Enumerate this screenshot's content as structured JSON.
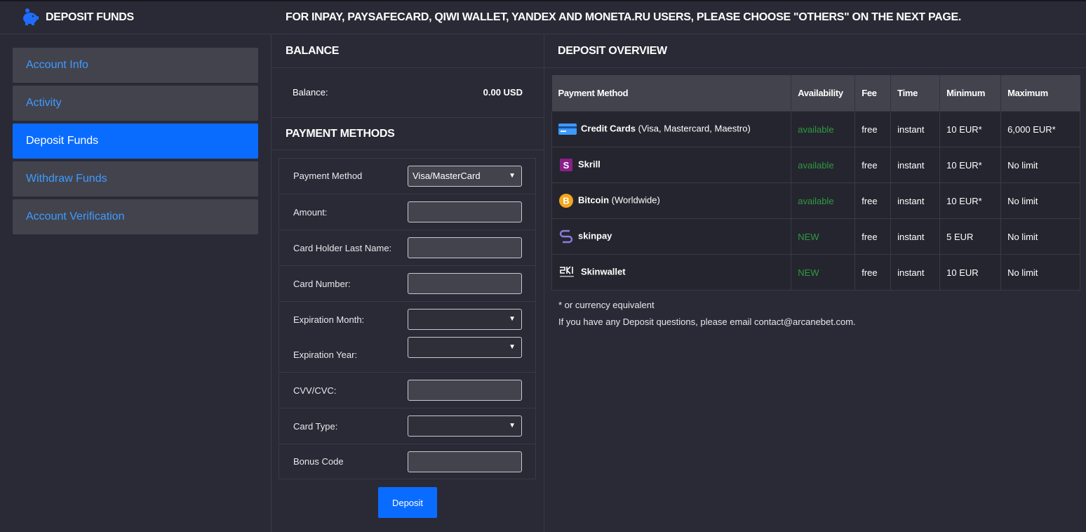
{
  "header": {
    "title": "DEPOSIT FUNDS",
    "notice": "FOR INPAY, PAYSAFECARD, QIWI WALLET, YANDEX AND MONETA.RU USERS, PLEASE CHOOSE \"OTHERS\" ON THE NEXT PAGE.",
    "icon": "piggy-bank-icon"
  },
  "sidebar": {
    "items": [
      {
        "label": "Account Info",
        "active": false
      },
      {
        "label": "Activity",
        "active": false
      },
      {
        "label": "Deposit Funds",
        "active": true
      },
      {
        "label": "Withdraw Funds",
        "active": false
      },
      {
        "label": "Account Verification",
        "active": false
      }
    ]
  },
  "balance": {
    "title": "BALANCE",
    "label": "Balance:",
    "value": "0.00 USD"
  },
  "payment_methods": {
    "title": "PAYMENT METHODS",
    "method_label": "Payment Method",
    "method_value": "Visa/MasterCard",
    "amount_label": "Amount:",
    "holder_label": "Card Holder Last Name:",
    "card_number_label": "Card Number:",
    "exp_month_label": "Expiration Month:",
    "exp_year_label": "Expiration Year:",
    "cvv_label": "CVV/CVC:",
    "card_type_label": "Card Type:",
    "bonus_label": "Bonus Code",
    "deposit_button": "Deposit"
  },
  "overview": {
    "title": "DEPOSIT OVERVIEW",
    "columns": [
      "Payment Method",
      "Availability",
      "Fee",
      "Time",
      "Minimum",
      "Maximum"
    ],
    "rows": [
      {
        "icon": "credit-card-icon",
        "name": "Credit Cards",
        "detail": " (Visa, Mastercard, Maestro)",
        "availability": "available",
        "fee": "free",
        "time": "instant",
        "minimum": "10 EUR*",
        "maximum": "6,000 EUR*"
      },
      {
        "icon": "skrill-icon",
        "name": "Skrill",
        "detail": "",
        "availability": "available",
        "fee": "free",
        "time": "instant",
        "minimum": "10 EUR*",
        "maximum": "No limit"
      },
      {
        "icon": "bitcoin-icon",
        "name": "Bitcoin",
        "detail": " (Worldwide)",
        "availability": "available",
        "fee": "free",
        "time": "instant",
        "minimum": "10 EUR*",
        "maximum": "No limit"
      },
      {
        "icon": "skinpay-icon",
        "name": "skinpay",
        "detail": "",
        "availability": "NEW",
        "fee": "free",
        "time": "instant",
        "minimum": "5 EUR",
        "maximum": "No limit"
      },
      {
        "icon": "skinwallet-icon",
        "name": "Skinwallet",
        "detail": "",
        "availability": "NEW",
        "fee": "free",
        "time": "instant",
        "minimum": "10 EUR",
        "maximum": "No limit"
      }
    ],
    "footnote": "* or currency equivalent",
    "contact_note": "If you have any Deposit questions, please email contact@arcanebet.com."
  },
  "colors": {
    "background": "#2a2a36",
    "panel": "#43434e",
    "accent": "#0a6cff",
    "link": "#3d9bff",
    "available": "#2d9a3f"
  }
}
